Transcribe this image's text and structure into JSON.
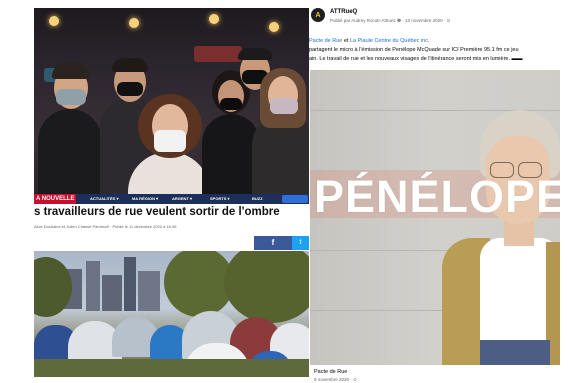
{
  "news_article": {
    "brand": "A NOUVELLE",
    "nav_items": [
      "ACTUALITÉS ▾",
      "MA RÉGION ▾",
      "ARGENT ▾",
      "SPORTS ▾",
      "BUZZ"
    ],
    "headline": "s travailleurs de rue veulent sortir de l'ombre",
    "byline": "Alice Duchaine et Julien Chassé Pamesoll · Publié le 11 décembre 2020 à 16:35",
    "share_facebook": "f",
    "share_twitter": "t"
  },
  "fb_post": {
    "avatar_letter": "A",
    "page_name": "ATTRueQ",
    "meta": "Publié par Audrey Rocotr-Attruez ❷ · 10 novembre 2020 · ⊙",
    "text_link_1": "Pacte de Rue",
    "text_connector": " et ",
    "text_link_2": "La Piaule Centre du Québec inc.",
    "text_line_2": "partagent le micro à l'émission de Penélope McQuade sur ICI Première 95.1 fm ce jeu",
    "text_line_3": "ain. Le travail de rue et les nouveaux visages de l'itinérance seront mis en lumière. ▬▬",
    "graphic_title": "PÉNÉLOPE",
    "link_title": "Pacte de Rue",
    "link_date": "9 novembre 2020 · ⊙"
  }
}
